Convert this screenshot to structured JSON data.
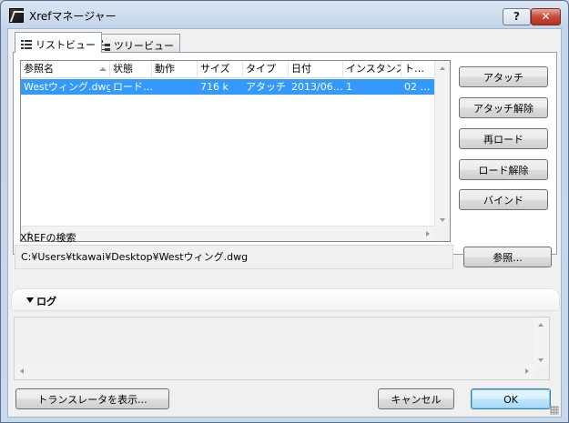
{
  "window": {
    "title": "Xrefマネージャー",
    "help_label": "?",
    "close_label": "✕"
  },
  "tabs": [
    {
      "label": "リストビュー"
    },
    {
      "label": "ツリービュー"
    }
  ],
  "table": {
    "columns": [
      "参照名",
      "状態",
      "動作",
      "サイズ",
      "タイプ",
      "日付",
      "インスタンス",
      "ト…"
    ],
    "rows": [
      {
        "name": "Westウィング.dwg",
        "status": "ロード…",
        "action": "",
        "size": "716 k",
        "type": "アタッチ",
        "date": "2013/06…",
        "instances": "1",
        "t": "02 …"
      }
    ]
  },
  "actions": {
    "attach": "アタッチ",
    "detach": "アタッチ解除",
    "reload": "再ロード",
    "unload": "ロード解除",
    "bind": "バインド"
  },
  "search": {
    "label": "XREFの検索",
    "path": "C:¥Users¥tkawai¥Desktop¥Westウィング.dwg",
    "browse": "参照..."
  },
  "log": {
    "title": "ログ"
  },
  "footer": {
    "show_translator": "トランスレータを表示...",
    "cancel": "キャンセル",
    "ok": "OK"
  },
  "colors": {
    "selection": "#3399ff",
    "title_bar": "#c8d9ec",
    "close_button": "#c74a38"
  }
}
